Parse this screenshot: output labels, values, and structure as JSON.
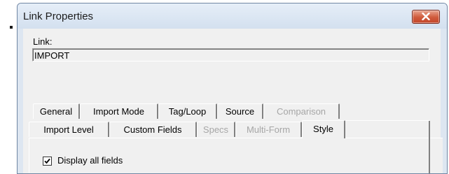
{
  "window": {
    "title": "Link Properties",
    "close_icon": "close-x-icon",
    "close_color": "#c4462a"
  },
  "link": {
    "label": "Link:",
    "value": "IMPORT"
  },
  "tabs": {
    "row1": [
      {
        "label": "General",
        "disabled": false
      },
      {
        "label": "Import Mode",
        "disabled": false
      },
      {
        "label": "Tag/Loop",
        "disabled": false
      },
      {
        "label": "Source",
        "disabled": false
      },
      {
        "label": "Comparison",
        "disabled": true
      }
    ],
    "row2": [
      {
        "label": "Import Level",
        "disabled": false
      },
      {
        "label": "Custom Fields",
        "disabled": false
      },
      {
        "label": "Specs",
        "disabled": true
      },
      {
        "label": "Multi-Form",
        "disabled": true
      },
      {
        "label": "Style",
        "disabled": false,
        "active": true
      }
    ]
  },
  "style_tab": {
    "display_all_fields": {
      "label": "Display all fields",
      "checked": true
    }
  }
}
